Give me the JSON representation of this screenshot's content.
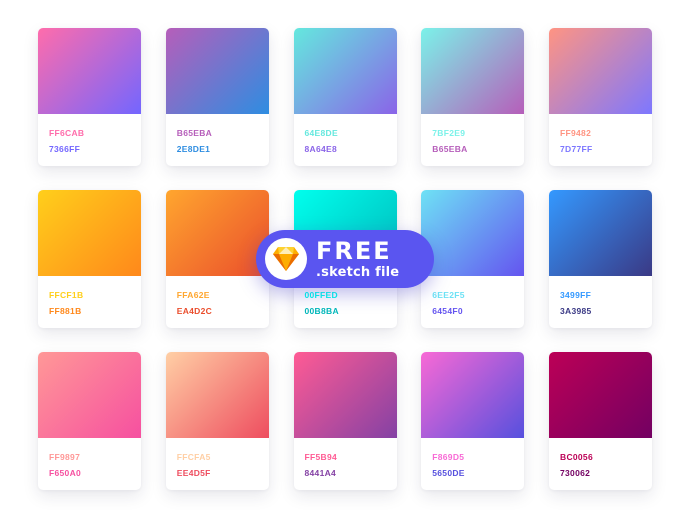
{
  "badge": {
    "title": "FREE",
    "subtitle": ".sketch file",
    "icon": "sketch-diamond-icon",
    "background": "#5a55f0"
  },
  "gradients": [
    {
      "from": "#FF6CAB",
      "to": "#7366FF",
      "label_from": "FF6CAB",
      "label_to": "7366FF"
    },
    {
      "from": "#B65EBA",
      "to": "#2E8DE1",
      "label_from": "B65EBA",
      "label_to": "2E8DE1"
    },
    {
      "from": "#64E8DE",
      "to": "#8A64E8",
      "label_from": "64E8DE",
      "label_to": "8A64E8"
    },
    {
      "from": "#7BF2E9",
      "to": "#B65EBA",
      "label_from": "7BF2E9",
      "label_to": "B65EBA"
    },
    {
      "from": "#FF9482",
      "to": "#7D77FF",
      "label_from": "FF9482",
      "label_to": "7D77FF"
    },
    {
      "from": "#FFCF1B",
      "to": "#FF881B",
      "label_from": "FFCF1B",
      "label_to": "FF881B"
    },
    {
      "from": "#FFA62E",
      "to": "#EA4D2C",
      "label_from": "FFA62E",
      "label_to": "EA4D2C"
    },
    {
      "from": "#00FFED",
      "to": "#00B8BA",
      "label_from": "00FFED",
      "label_to": "00B8BA"
    },
    {
      "from": "#6EE2F5",
      "to": "#6454F0",
      "label_from": "6EE2F5",
      "label_to": "6454F0"
    },
    {
      "from": "#3499FF",
      "to": "#3A3985",
      "label_from": "3499FF",
      "label_to": "3A3985"
    },
    {
      "from": "#FF9897",
      "to": "#F650A0",
      "label_from": "FF9897",
      "label_to": "F650A0"
    },
    {
      "from": "#FFCFA5",
      "to": "#EE4D5F",
      "label_from": "FFCFA5",
      "label_to": "EE4D5F"
    },
    {
      "from": "#FF5B94",
      "to": "#8441A4",
      "label_from": "FF5B94",
      "label_to": "8441A4"
    },
    {
      "from": "#F869D5",
      "to": "#5650DE",
      "label_from": "F869D5",
      "label_to": "5650DE"
    },
    {
      "from": "#BC0056",
      "to": "#730062",
      "label_from": "BC0056",
      "label_to": "730062"
    }
  ]
}
